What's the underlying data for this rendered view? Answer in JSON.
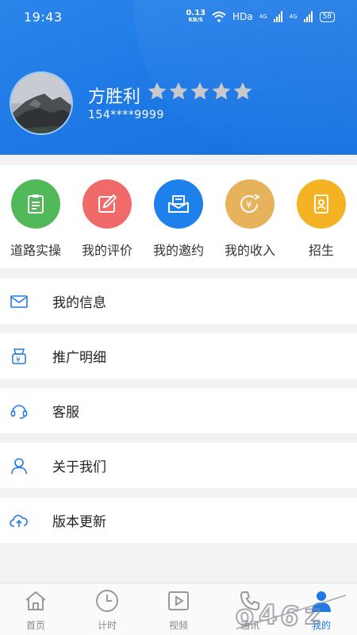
{
  "status": {
    "time": "19:43",
    "speed_value": "0.13",
    "speed_unit": "KB/S",
    "hd": "HDa",
    "net1": "4G",
    "net2": "4G",
    "battery": "58"
  },
  "profile": {
    "name": "方胜利",
    "phone": "154****9999",
    "rating": 5,
    "rating_max": 5
  },
  "quick_actions": [
    {
      "label": "道路实操",
      "icon": "clipboard-icon",
      "color": "#52b95a"
    },
    {
      "label": "我的评价",
      "icon": "edit-icon",
      "color": "#f06a6a"
    },
    {
      "label": "我的邀约",
      "icon": "invitation-icon",
      "color": "#1e80ea"
    },
    {
      "label": "我的收入",
      "icon": "income-icon",
      "color": "#e6b25b"
    },
    {
      "label": "招生",
      "icon": "recruit-icon",
      "color": "#f4b322"
    }
  ],
  "menu": [
    {
      "label": "我的信息",
      "icon": "mail-icon"
    },
    {
      "label": "推广明细",
      "icon": "promotion-icon"
    },
    {
      "label": "客服",
      "icon": "headset-icon"
    },
    {
      "label": "关于我们",
      "icon": "user-icon"
    },
    {
      "label": "版本更新",
      "icon": "cloud-upload-icon"
    }
  ],
  "tabs": [
    {
      "label": "首页",
      "icon": "home-icon"
    },
    {
      "label": "计时",
      "icon": "clock-icon"
    },
    {
      "label": "视频",
      "icon": "video-icon"
    },
    {
      "label": "通讯",
      "icon": "phone-icon"
    },
    {
      "label": "我的",
      "icon": "profile-icon",
      "active": true
    }
  ],
  "colors": {
    "primary": "#1f7ae6",
    "star": "#c9c9c9"
  }
}
